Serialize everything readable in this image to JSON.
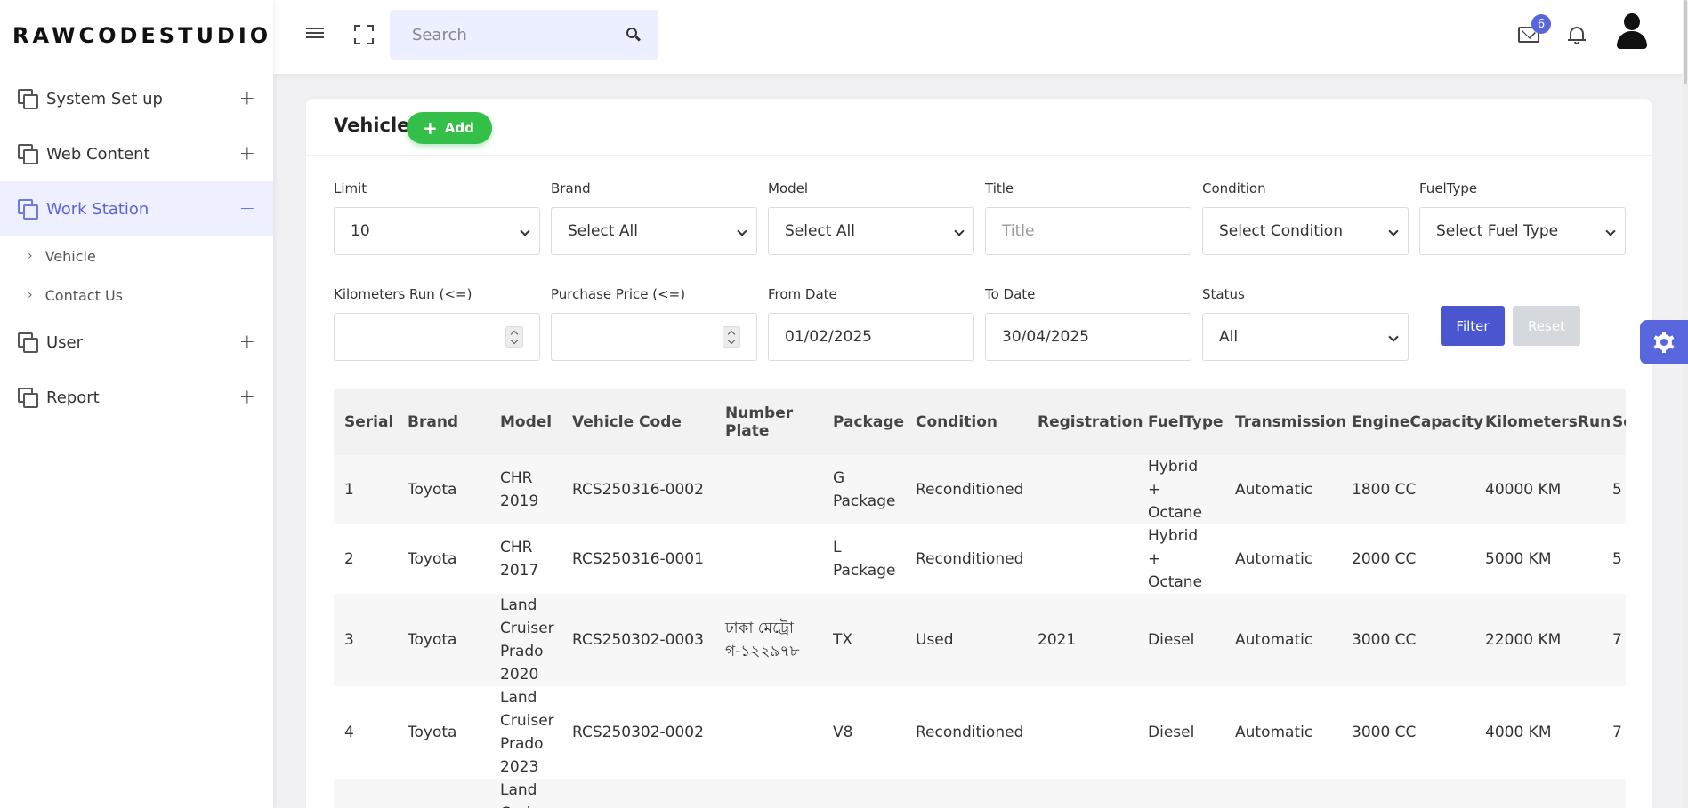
{
  "app": {
    "logo": "RAWCODESTUDIO"
  },
  "sidebar": {
    "items": [
      {
        "label": "System Set up",
        "toggle": "+"
      },
      {
        "label": "Web Content",
        "toggle": "+"
      },
      {
        "label": "Work Station",
        "toggle": "−",
        "active": true,
        "children": [
          "Vehicle",
          "Contact Us"
        ]
      },
      {
        "label": "User",
        "toggle": "+"
      },
      {
        "label": "Report",
        "toggle": "+"
      }
    ]
  },
  "topbar": {
    "search_placeholder": "Search",
    "mail_badge": "6"
  },
  "page": {
    "title": "Vehicle",
    "add_label": "Add"
  },
  "filters": {
    "limit": {
      "label": "Limit",
      "value": "10"
    },
    "brand": {
      "label": "Brand",
      "value": "Select All"
    },
    "model": {
      "label": "Model",
      "value": "Select All"
    },
    "title": {
      "label": "Title",
      "placeholder": "Title"
    },
    "condition": {
      "label": "Condition",
      "value": "Select Condition"
    },
    "fueltype": {
      "label": "FuelType",
      "value": "Select Fuel Type"
    },
    "km": {
      "label": "Kilometers Run (<=)",
      "value": ""
    },
    "price": {
      "label": "Purchase Price (<=)",
      "value": ""
    },
    "from_date": {
      "label": "From Date",
      "value": "01/02/2025"
    },
    "to_date": {
      "label": "To Date",
      "value": "30/04/2025"
    },
    "status": {
      "label": "Status",
      "value": "All"
    },
    "filter_btn": "Filter",
    "reset_btn": "Reset"
  },
  "table": {
    "columns": [
      "Serial",
      "Brand",
      "Model",
      "Vehicle Code",
      "Number Plate",
      "Package",
      "Condition",
      "Registration",
      "FuelType",
      "Transmission",
      "EngineCapacity",
      "KilometersRun",
      "Se"
    ],
    "rows": [
      [
        "1",
        "Toyota",
        "CHR 2019",
        "RCS250316-0002",
        "",
        "G Package",
        "Reconditioned",
        "",
        "Hybrid + Octane",
        "Automatic",
        "1800 CC",
        "40000 KM",
        "5"
      ],
      [
        "2",
        "Toyota",
        "CHR 2017",
        "RCS250316-0001",
        "",
        "L Package",
        "Reconditioned",
        "",
        "Hybrid + Octane",
        "Automatic",
        "2000 CC",
        "5000 KM",
        "5"
      ],
      [
        "3",
        "Toyota",
        "Land Cruiser Prado 2020",
        "RCS250302-0003",
        "ঢাকা মেট্রো গ-১২২৯৭৮",
        "TX",
        "Used",
        "2021",
        "Diesel",
        "Automatic",
        "3000 CC",
        "22000 KM",
        "7"
      ],
      [
        "4",
        "Toyota",
        "Land Cruiser Prado 2023",
        "RCS250302-0002",
        "",
        "V8",
        "Reconditioned",
        "",
        "Diesel",
        "Automatic",
        "3000 CC",
        "4000 KM",
        "7"
      ],
      [
        "",
        "",
        "Land Cruiser",
        "",
        "",
        "",
        "",
        "",
        "",
        "",
        "",
        "",
        ""
      ]
    ]
  }
}
